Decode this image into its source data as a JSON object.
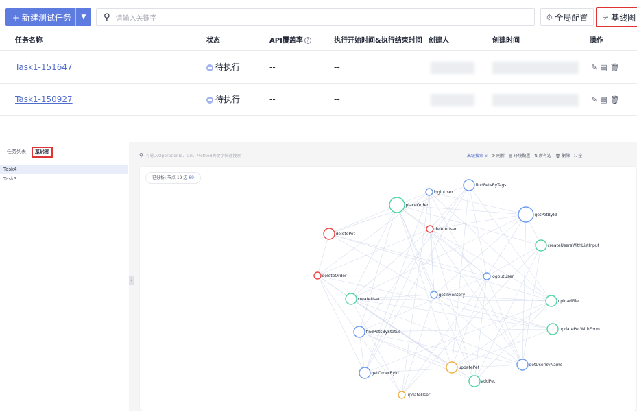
{
  "toolbar": {
    "new_task_label": "+ 新建测试任务",
    "dropdown_caret": "▼",
    "search_placeholder": "请输入关键字",
    "global_config_label": "全局配置",
    "baseline_label": "基线图"
  },
  "table": {
    "headers": [
      "任务名称",
      "状态",
      "API覆盖率",
      "执行开始时间&执行结束时间",
      "创建人",
      "创建时间",
      "操作"
    ],
    "rows": [
      {
        "name": "Task1-151647",
        "status": "待执行",
        "coverage": "--",
        "exec_time": "--"
      },
      {
        "name": "Task1-150927",
        "status": "待执行",
        "coverage": "--",
        "exec_time": "--"
      }
    ]
  },
  "baseline": {
    "tabs": [
      "任务列表",
      "基线图"
    ],
    "tasks": [
      "Task4",
      "Task3"
    ],
    "search_placeholder": "可输入OperationId、Url、Method关键字快速搜索",
    "actions": {
      "advanced": "高级搜索 ∨",
      "refresh": "刷新",
      "env_config": "环境配置",
      "all_edges": "所有边",
      "delete": "删除",
      "fullscreen": "全"
    },
    "stats": {
      "prefix": "已分析: 节点",
      "nodes": "19",
      "edges_label": "边",
      "edges": "69"
    },
    "colors": {
      "blue": "#6c9cf0",
      "green": "#50d4a0",
      "red": "#f04848",
      "orange": "#f0b040",
      "edge": "#d8deee"
    },
    "nodes": [
      {
        "id": "loginUser",
        "label": "loginUser",
        "color": "blue",
        "size": "s"
      },
      {
        "id": "findPetsByTags",
        "label": "findPetsByTags",
        "color": "blue",
        "size": "m"
      },
      {
        "id": "placeOrder",
        "label": "placeOrder",
        "color": "green",
        "size": "l"
      },
      {
        "id": "getPetById",
        "label": "getPetById",
        "color": "blue",
        "size": "l"
      },
      {
        "id": "deletePet",
        "label": "deletePet",
        "color": "red",
        "size": "m"
      },
      {
        "id": "deleteUser",
        "label": "deleteUser",
        "color": "red",
        "size": "s"
      },
      {
        "id": "createUsersWithListInput",
        "label": "createUsersWithListInput",
        "color": "green",
        "size": "m"
      },
      {
        "id": "deleteOrder",
        "label": "deleteOrder",
        "color": "red",
        "size": "s"
      },
      {
        "id": "logoutUser",
        "label": "logoutUser",
        "color": "blue",
        "size": "s"
      },
      {
        "id": "createUser",
        "label": "createUser",
        "color": "green",
        "size": "m"
      },
      {
        "id": "getInventory",
        "label": "getInventory",
        "color": "blue",
        "size": "s"
      },
      {
        "id": "uploadFile",
        "label": "uploadFile",
        "color": "green",
        "size": "m"
      },
      {
        "id": "findPetsByStatus",
        "label": "findPetsByStatus",
        "color": "blue",
        "size": "m"
      },
      {
        "id": "updatePetWithForm",
        "label": "updatePetWithForm",
        "color": "green",
        "size": "m"
      },
      {
        "id": "getUserByName",
        "label": "getUserByName",
        "color": "blue",
        "size": "m"
      },
      {
        "id": "updatePet",
        "label": "updatePet",
        "color": "orange",
        "size": "m"
      },
      {
        "id": "getOrderById",
        "label": "getOrderById",
        "color": "blue",
        "size": "m"
      },
      {
        "id": "addPet",
        "label": "addPet",
        "color": "green",
        "size": "m"
      },
      {
        "id": "updateUser",
        "label": "updateUser",
        "color": "orange",
        "size": "s"
      }
    ]
  }
}
